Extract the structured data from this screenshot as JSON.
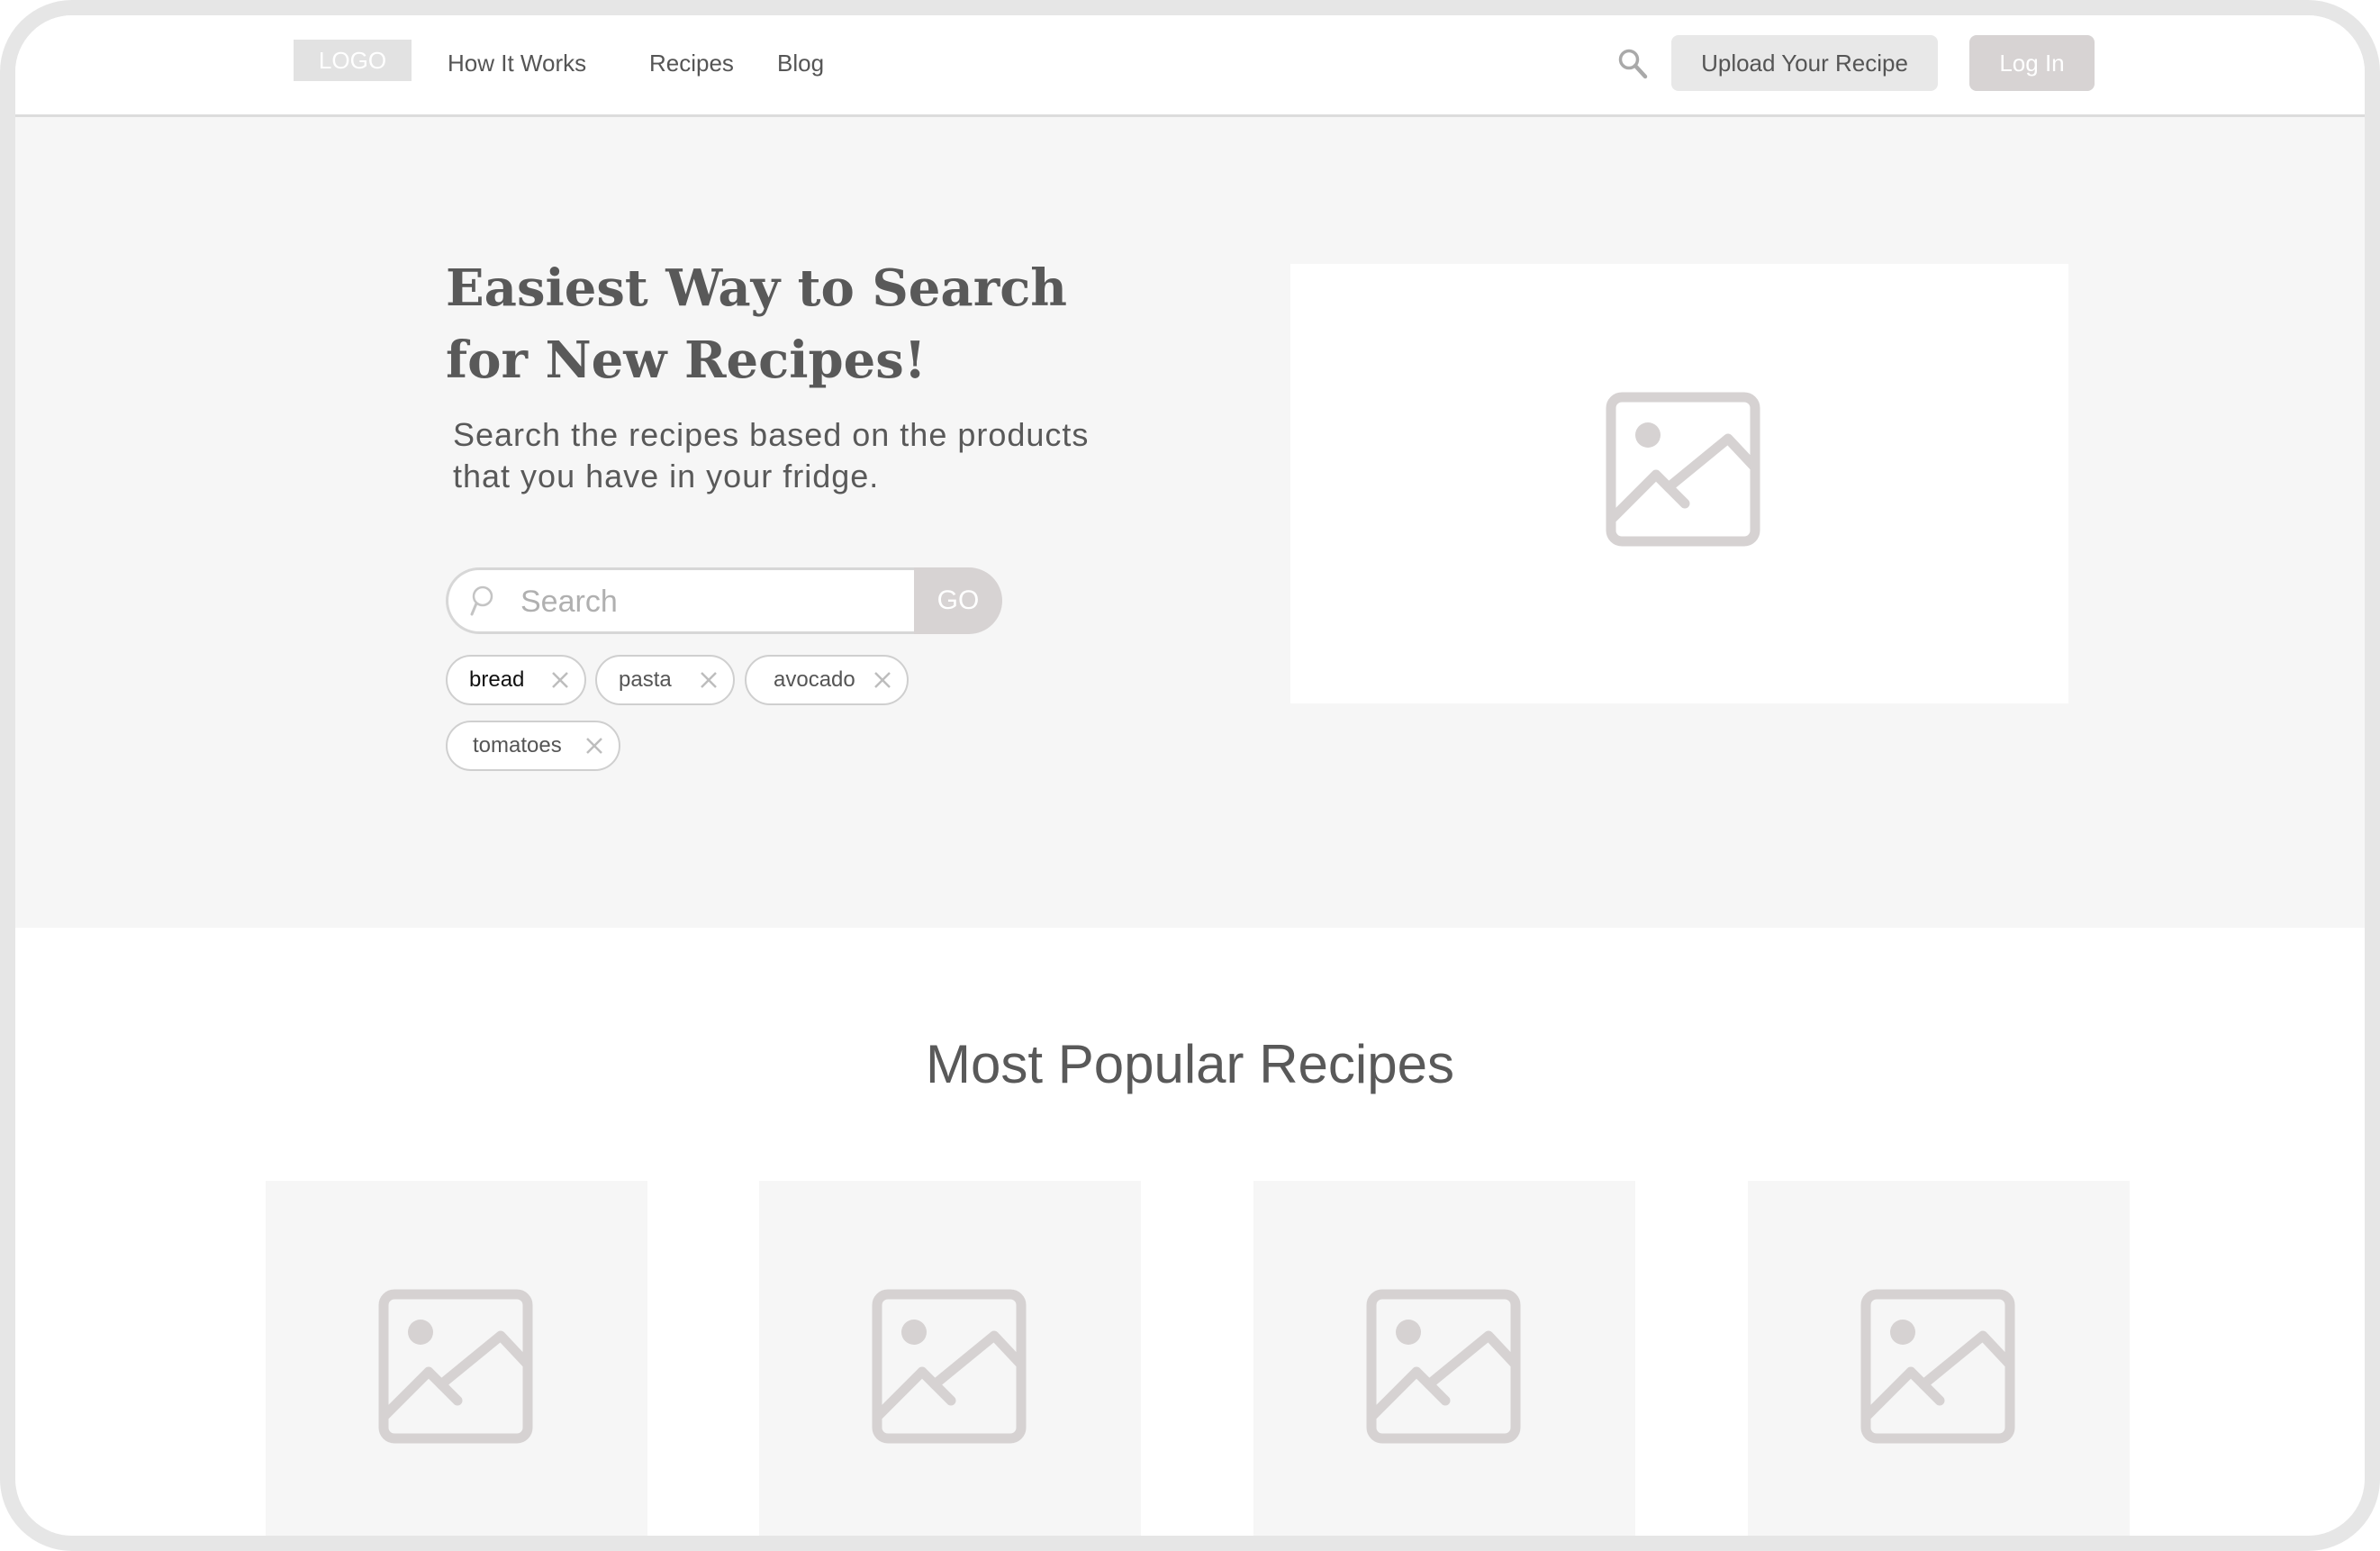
{
  "navbar": {
    "logo": "LOGO",
    "links": [
      "How It Works",
      "Recipes",
      "Blog"
    ],
    "search_icon": "search-icon",
    "upload_button": "Upload Your Recipe",
    "login_button": "Log In"
  },
  "hero": {
    "title_line1": "Easiest Way to Search",
    "title_line2": "for New Recipes!",
    "subtitle_line1": "Search the recipes based on the products",
    "subtitle_line2": "that you have in your fridge.",
    "search": {
      "placeholder": "Search",
      "value": "",
      "go_label": "GO"
    },
    "tags": [
      {
        "label": "bread",
        "remove_icon": "close-icon"
      },
      {
        "label": "pasta",
        "remove_icon": "close-icon"
      },
      {
        "label": "avocado",
        "remove_icon": "close-icon"
      },
      {
        "label": "tomatoes",
        "remove_icon": "close-icon"
      }
    ],
    "image_icon": "image-placeholder-icon"
  },
  "popular": {
    "title": "Most Popular Recipes",
    "cards": [
      {
        "image_icon": "image-placeholder-icon"
      },
      {
        "image_icon": "image-placeholder-icon"
      },
      {
        "image_icon": "image-placeholder-icon"
      },
      {
        "image_icon": "image-placeholder-icon"
      }
    ]
  },
  "colors": {
    "frame": "#e6e6e6",
    "hero_background": "#f6f6f6",
    "text": "#595959",
    "placeholder_icon": "#d6d2d2",
    "button_gray": "#e8e8e8",
    "button_dark_gray": "#d7d3d3"
  }
}
